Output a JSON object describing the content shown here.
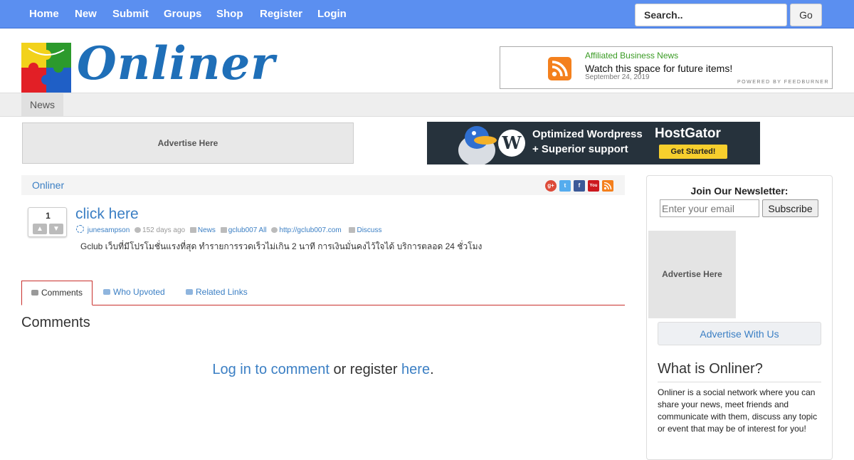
{
  "nav": {
    "items": [
      "Home",
      "New",
      "Submit",
      "Groups",
      "Shop",
      "Register",
      "Login"
    ],
    "search_placeholder": "Search..",
    "go_label": "Go"
  },
  "logo": {
    "text": "Onliner"
  },
  "feed": {
    "title": "Affiliated Business News",
    "item": "Watch this space for future items!",
    "date": "September 24, 2019",
    "powered": "POWERED BY FEEDBURNER"
  },
  "subnav": {
    "tab": "News"
  },
  "ads": {
    "left_label": "Advertise Here",
    "banner_line1": "Optimized Wordpress",
    "banner_line2": "+ Superior support",
    "banner_brand": "HostGator",
    "banner_cta": "Get Started!"
  },
  "breadcrumb": {
    "label": "Onliner"
  },
  "social_icons": [
    "google-plus-icon",
    "twitter-icon",
    "facebook-icon",
    "youtube-icon",
    "rss-icon"
  ],
  "story": {
    "votes": "1",
    "title": "click here",
    "author": "junesampson",
    "age": "152 days ago",
    "category": "News",
    "tags": "gclub007 All",
    "url": "http://gclub007.com",
    "discuss": "Discuss",
    "description": "Gclub เว็บที่มีโปรโมชั่นแรงที่สุด ทำรายการรวดเร็วไม่เกิน 2 นาที การเงินมั่นคงไว้ใจได้ บริการตลอด 24 ชั่วโมง"
  },
  "tabs": {
    "comments": "Comments",
    "who_upvoted": "Who Upvoted",
    "related_links": "Related Links"
  },
  "comments": {
    "heading": "Comments",
    "login_link": "Log in to comment",
    "middle": " or register ",
    "here_link": "here",
    "end": "."
  },
  "sidebar": {
    "newsletter_title": "Join Our Newsletter:",
    "email_placeholder": "Enter your email",
    "subscribe_label": "Subscribe",
    "ad_label": "Advertise Here",
    "advertise_with_us": "Advertise With Us",
    "what_title": "What is Onliner?",
    "what_text": "Onliner is a social network where you can share your news, meet friends and communicate with them, discuss any topic or event that may be of interest for you!"
  },
  "colors": {
    "nav_bg": "#5b8ff0",
    "link": "#3b7fc4",
    "tab_accent": "#c9302c",
    "feed_title": "#3a9b24",
    "rss_orange": "#f4801d"
  }
}
